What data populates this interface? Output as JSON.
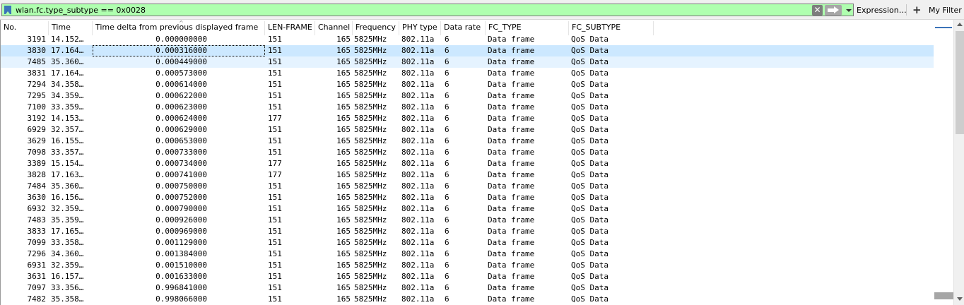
{
  "filter": {
    "text": "wlan.fc.type_subtype == 0x0028",
    "clear_glyph": "✕",
    "expression_label": "Expression…",
    "plus_glyph": "+",
    "my_filter_label": "My Filter",
    "background_color": "#afffaf"
  },
  "columns": [
    "No.",
    "Time",
    "Time delta from previous displayed frame",
    "LEN-FRAME",
    "Channel",
    "Frequency",
    "PHY type",
    "Data rate",
    "FC_TYPE",
    "FC_SUBTYPE"
  ],
  "rows": [
    {
      "no": "3191",
      "time": "14.152…",
      "delta": "0.000000000",
      "len": "151",
      "channel": "165",
      "freq": "5825MHz",
      "phy": "802.11a",
      "rate": "6",
      "fc_type": "Data frame",
      "fc_subtype": "QoS Data"
    },
    {
      "no": "3830",
      "time": "17.164…",
      "delta": "0.000316000",
      "len": "151",
      "channel": "165",
      "freq": "5825MHz",
      "phy": "802.11a",
      "rate": "6",
      "fc_type": "Data frame",
      "fc_subtype": "QoS Data",
      "selected": true
    },
    {
      "no": "7485",
      "time": "35.360…",
      "delta": "0.000449000",
      "len": "151",
      "channel": "165",
      "freq": "5825MHz",
      "phy": "802.11a",
      "rate": "6",
      "fc_type": "Data frame",
      "fc_subtype": "QoS Data",
      "related": true
    },
    {
      "no": "3831",
      "time": "17.164…",
      "delta": "0.000573000",
      "len": "151",
      "channel": "165",
      "freq": "5825MHz",
      "phy": "802.11a",
      "rate": "6",
      "fc_type": "Data frame",
      "fc_subtype": "QoS Data"
    },
    {
      "no": "7294",
      "time": "34.358…",
      "delta": "0.000614000",
      "len": "151",
      "channel": "165",
      "freq": "5825MHz",
      "phy": "802.11a",
      "rate": "6",
      "fc_type": "Data frame",
      "fc_subtype": "QoS Data"
    },
    {
      "no": "7295",
      "time": "34.359…",
      "delta": "0.000622000",
      "len": "151",
      "channel": "165",
      "freq": "5825MHz",
      "phy": "802.11a",
      "rate": "6",
      "fc_type": "Data frame",
      "fc_subtype": "QoS Data"
    },
    {
      "no": "7100",
      "time": "33.359…",
      "delta": "0.000623000",
      "len": "151",
      "channel": "165",
      "freq": "5825MHz",
      "phy": "802.11a",
      "rate": "6",
      "fc_type": "Data frame",
      "fc_subtype": "QoS Data"
    },
    {
      "no": "3192",
      "time": "14.153…",
      "delta": "0.000624000",
      "len": "177",
      "channel": "165",
      "freq": "5825MHz",
      "phy": "802.11a",
      "rate": "6",
      "fc_type": "Data frame",
      "fc_subtype": "QoS Data"
    },
    {
      "no": "6929",
      "time": "32.357…",
      "delta": "0.000629000",
      "len": "151",
      "channel": "165",
      "freq": "5825MHz",
      "phy": "802.11a",
      "rate": "6",
      "fc_type": "Data frame",
      "fc_subtype": "QoS Data"
    },
    {
      "no": "3629",
      "time": "16.155…",
      "delta": "0.000653000",
      "len": "151",
      "channel": "165",
      "freq": "5825MHz",
      "phy": "802.11a",
      "rate": "6",
      "fc_type": "Data frame",
      "fc_subtype": "QoS Data"
    },
    {
      "no": "7098",
      "time": "33.357…",
      "delta": "0.000733000",
      "len": "151",
      "channel": "165",
      "freq": "5825MHz",
      "phy": "802.11a",
      "rate": "6",
      "fc_type": "Data frame",
      "fc_subtype": "QoS Data"
    },
    {
      "no": "3389",
      "time": "15.154…",
      "delta": "0.000734000",
      "len": "177",
      "channel": "165",
      "freq": "5825MHz",
      "phy": "802.11a",
      "rate": "6",
      "fc_type": "Data frame",
      "fc_subtype": "QoS Data"
    },
    {
      "no": "3828",
      "time": "17.163…",
      "delta": "0.000741000",
      "len": "177",
      "channel": "165",
      "freq": "5825MHz",
      "phy": "802.11a",
      "rate": "6",
      "fc_type": "Data frame",
      "fc_subtype": "QoS Data"
    },
    {
      "no": "7484",
      "time": "35.360…",
      "delta": "0.000750000",
      "len": "151",
      "channel": "165",
      "freq": "5825MHz",
      "phy": "802.11a",
      "rate": "6",
      "fc_type": "Data frame",
      "fc_subtype": "QoS Data"
    },
    {
      "no": "3630",
      "time": "16.156…",
      "delta": "0.000752000",
      "len": "151",
      "channel": "165",
      "freq": "5825MHz",
      "phy": "802.11a",
      "rate": "6",
      "fc_type": "Data frame",
      "fc_subtype": "QoS Data"
    },
    {
      "no": "6932",
      "time": "32.359…",
      "delta": "0.000790000",
      "len": "151",
      "channel": "165",
      "freq": "5825MHz",
      "phy": "802.11a",
      "rate": "6",
      "fc_type": "Data frame",
      "fc_subtype": "QoS Data"
    },
    {
      "no": "7483",
      "time": "35.359…",
      "delta": "0.000926000",
      "len": "151",
      "channel": "165",
      "freq": "5825MHz",
      "phy": "802.11a",
      "rate": "6",
      "fc_type": "Data frame",
      "fc_subtype": "QoS Data"
    },
    {
      "no": "3833",
      "time": "17.165…",
      "delta": "0.000969000",
      "len": "151",
      "channel": "165",
      "freq": "5825MHz",
      "phy": "802.11a",
      "rate": "6",
      "fc_type": "Data frame",
      "fc_subtype": "QoS Data"
    },
    {
      "no": "7099",
      "time": "33.358…",
      "delta": "0.001129000",
      "len": "151",
      "channel": "165",
      "freq": "5825MHz",
      "phy": "802.11a",
      "rate": "6",
      "fc_type": "Data frame",
      "fc_subtype": "QoS Data"
    },
    {
      "no": "7296",
      "time": "34.360…",
      "delta": "0.001384000",
      "len": "151",
      "channel": "165",
      "freq": "5825MHz",
      "phy": "802.11a",
      "rate": "6",
      "fc_type": "Data frame",
      "fc_subtype": "QoS Data"
    },
    {
      "no": "6931",
      "time": "32.359…",
      "delta": "0.001510000",
      "len": "151",
      "channel": "165",
      "freq": "5825MHz",
      "phy": "802.11a",
      "rate": "6",
      "fc_type": "Data frame",
      "fc_subtype": "QoS Data"
    },
    {
      "no": "3631",
      "time": "16.157…",
      "delta": "0.001633000",
      "len": "151",
      "channel": "165",
      "freq": "5825MHz",
      "phy": "802.11a",
      "rate": "6",
      "fc_type": "Data frame",
      "fc_subtype": "QoS Data"
    },
    {
      "no": "7097",
      "time": "33.356…",
      "delta": "0.996841000",
      "len": "151",
      "channel": "165",
      "freq": "5825MHz",
      "phy": "802.11a",
      "rate": "6",
      "fc_type": "Data frame",
      "fc_subtype": "QoS Data"
    },
    {
      "no": "7482",
      "time": "35.358…",
      "delta": "0.998066000",
      "len": "151",
      "channel": "165",
      "freq": "5825MHz",
      "phy": "802.11a",
      "rate": "6",
      "fc_type": "Data frame",
      "fc_subtype": "QoS Data"
    }
  ],
  "colors": {
    "selected_row": "#cce8ff",
    "related_row": "#e5f3ff"
  }
}
